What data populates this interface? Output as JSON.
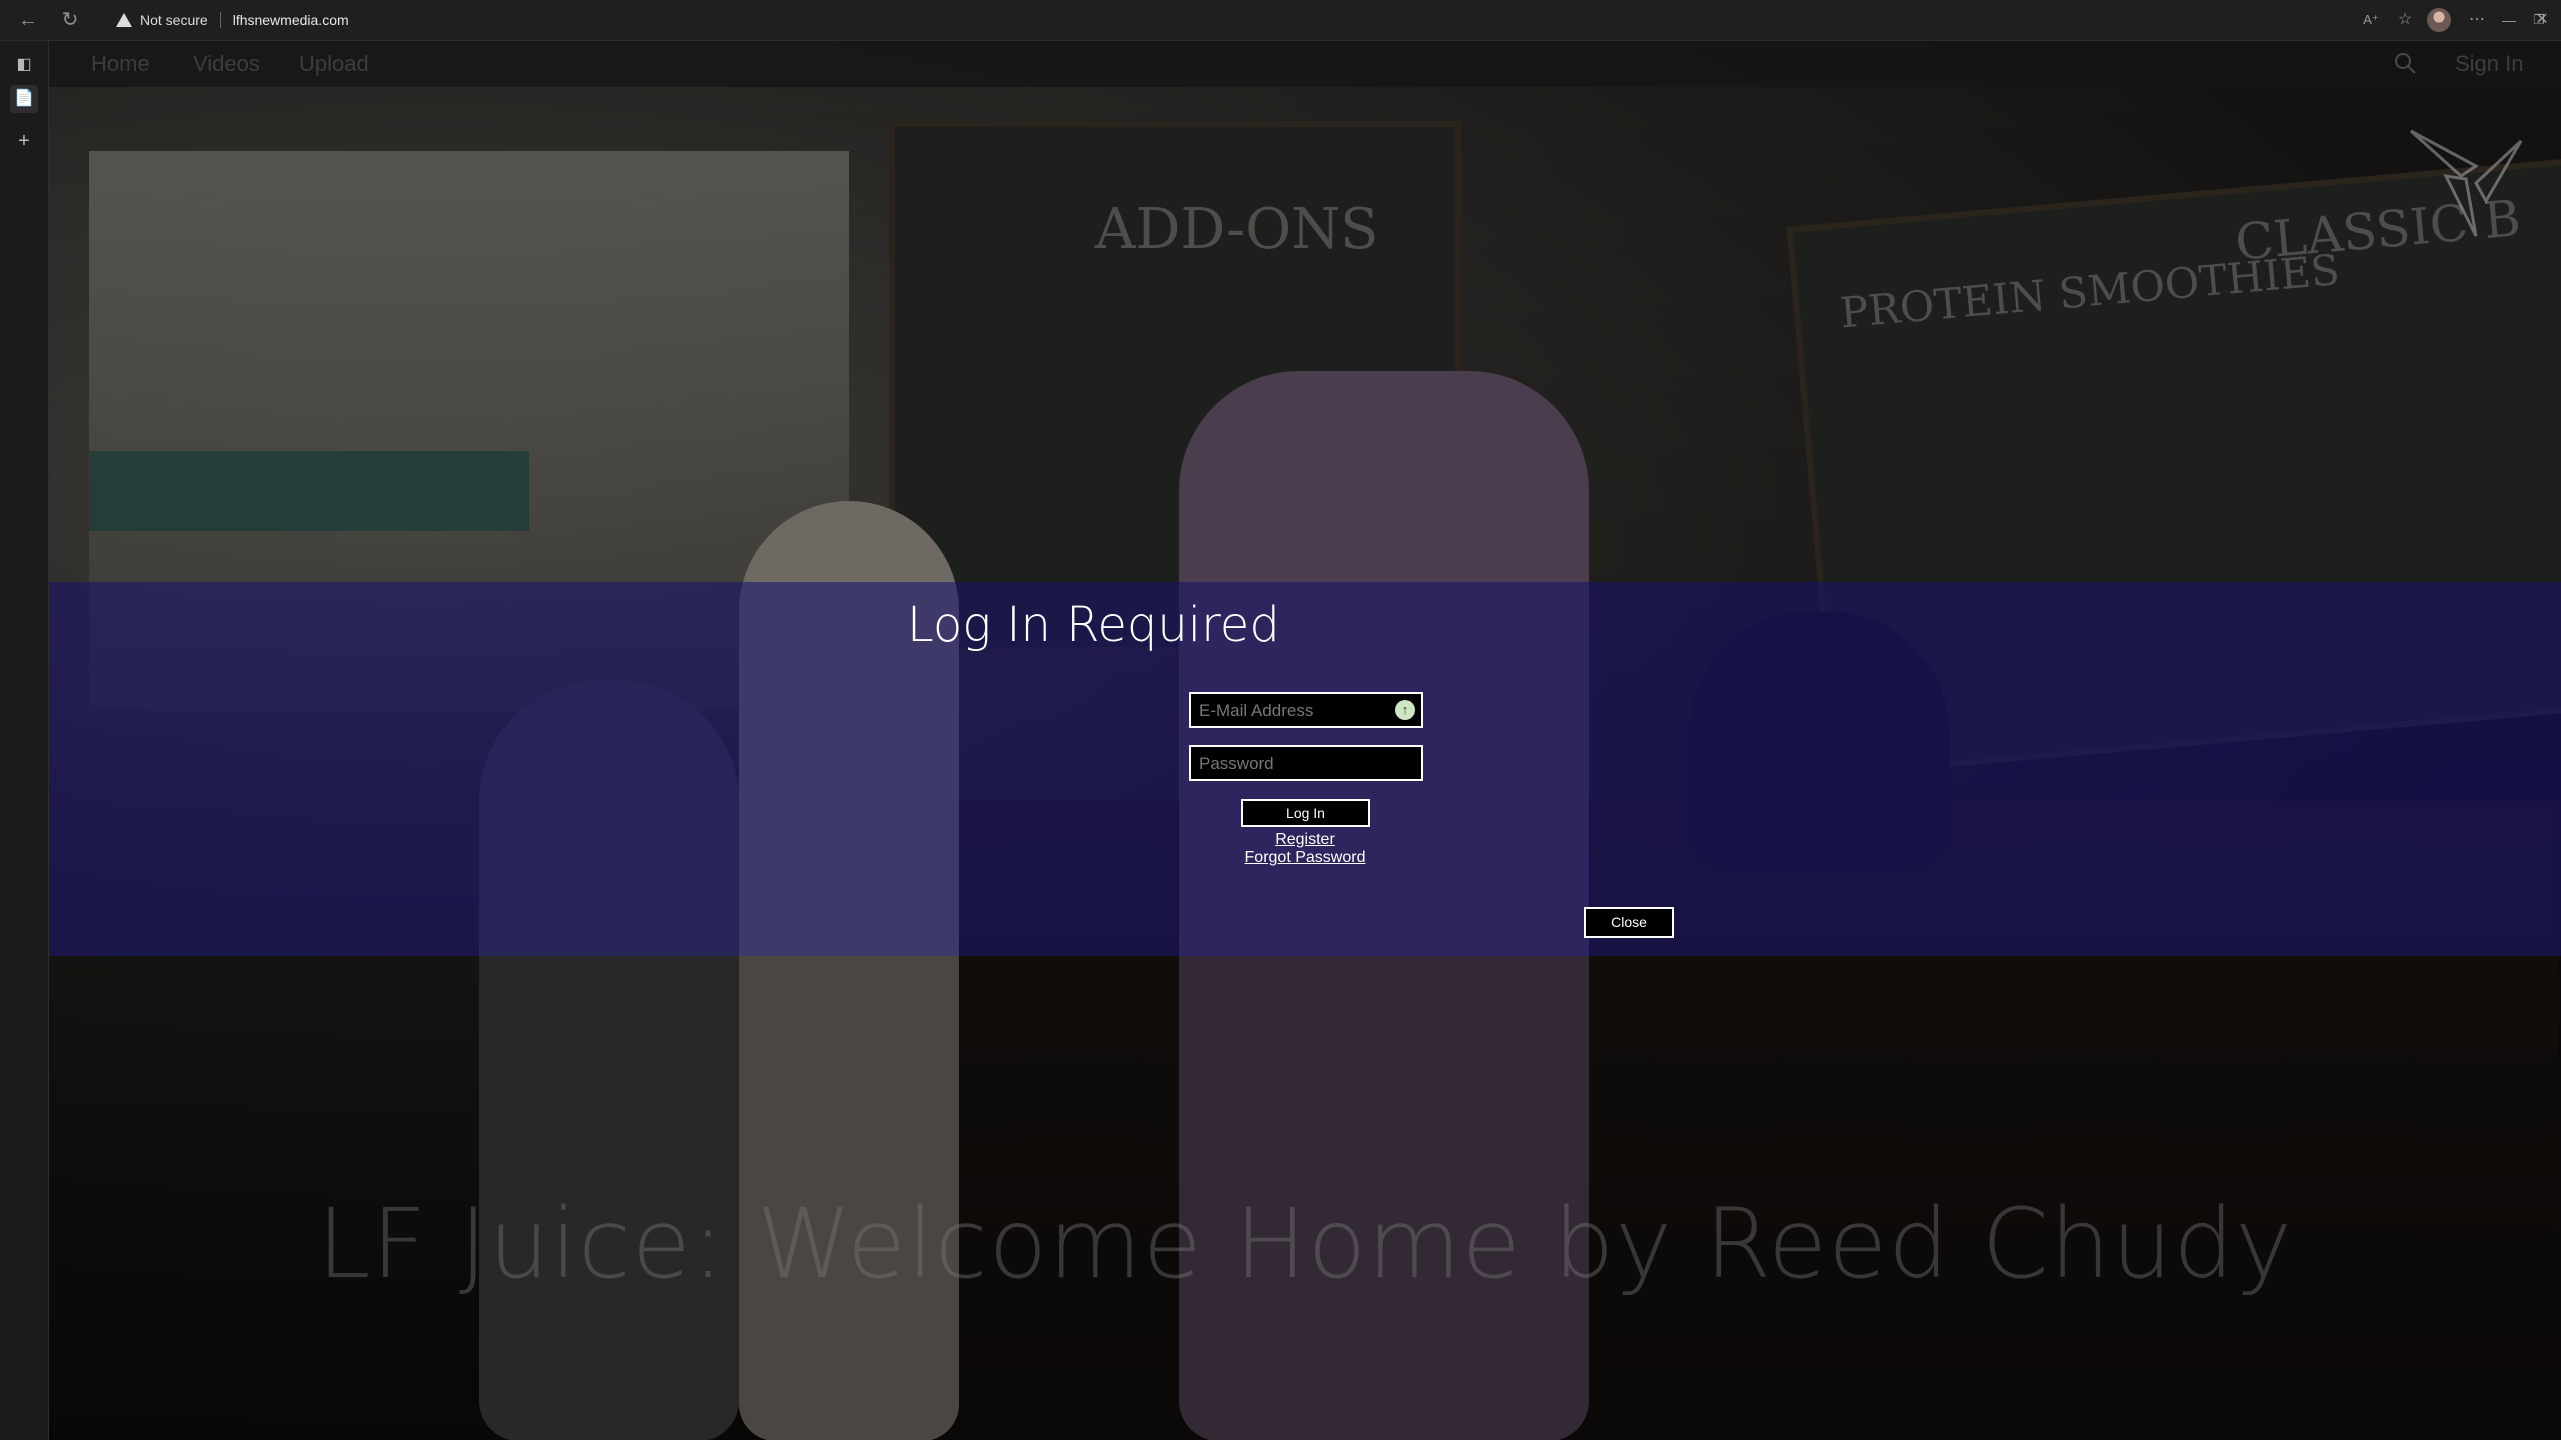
{
  "browser": {
    "security_label": "Not secure",
    "url": "lfhsnewmedia.com"
  },
  "nav": {
    "links": [
      "Home",
      "Videos",
      "Upload"
    ],
    "sign_in": "Sign In"
  },
  "modal": {
    "title": "Log In Required",
    "email_placeholder": "E-Mail Address",
    "password_placeholder": "Password",
    "login_button": "Log In",
    "register_link": "Register",
    "forgot_link": "Forgot Password",
    "close_button": "Close"
  },
  "video": {
    "title": "LF Juice: Welcome Home by Reed Chudy"
  },
  "background": {
    "menu_boards": [
      "ADD-ONS",
      "PROTEIN SMOOTHIES",
      "CLASSIC B"
    ]
  },
  "colors": {
    "band": "#16126e",
    "modal_text": "#ffffff",
    "chrome": "#1f1f1f"
  }
}
